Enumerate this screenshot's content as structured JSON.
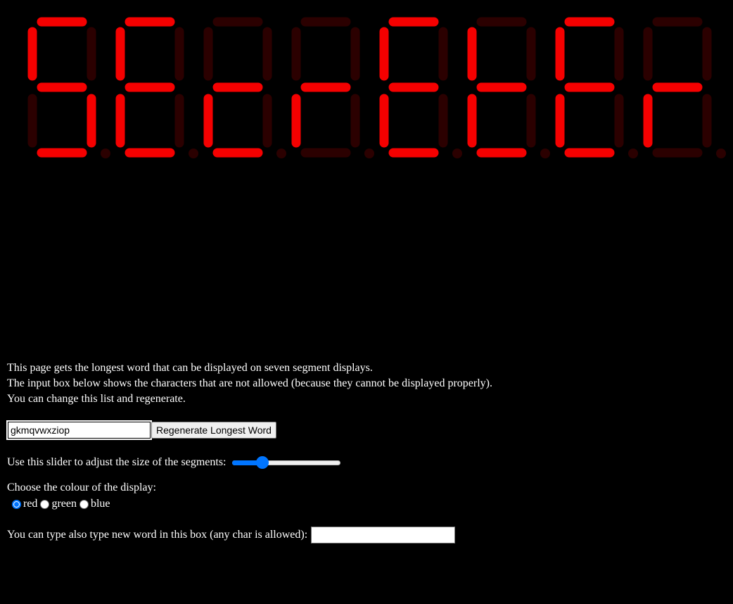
{
  "display": {
    "word": "SEcrEtEr",
    "on_color": "#f50000",
    "off_color": "#2b0000",
    "digits": [
      {
        "char": "S",
        "segments": [
          "a",
          "f",
          "g",
          "c",
          "d"
        ]
      },
      {
        "char": "E",
        "segments": [
          "a",
          "f",
          "g",
          "e",
          "d"
        ]
      },
      {
        "char": "c",
        "segments": [
          "g",
          "e",
          "d"
        ]
      },
      {
        "char": "r",
        "segments": [
          "g",
          "e"
        ]
      },
      {
        "char": "E",
        "segments": [
          "a",
          "f",
          "g",
          "e",
          "d"
        ]
      },
      {
        "char": "t",
        "segments": [
          "f",
          "g",
          "e",
          "d"
        ]
      },
      {
        "char": "E",
        "segments": [
          "a",
          "f",
          "g",
          "e",
          "d"
        ]
      },
      {
        "char": "r",
        "segments": [
          "g",
          "e"
        ]
      }
    ]
  },
  "intro": {
    "line1": "This page gets the longest word that can be displayed on seven segment displays.",
    "line2": "The input box below shows the characters that are not allowed (because they cannot be displayed properly).",
    "line3": "You can change this list and regenerate."
  },
  "disallowed": {
    "value": "gkmqvwxziop",
    "button_label": "Regenerate Longest Word"
  },
  "slider": {
    "label": "Use this slider to adjust the size of the segments:",
    "min": 0,
    "max": 100,
    "value": 25
  },
  "colour": {
    "label": "Choose the colour of the display:",
    "options": [
      {
        "label": "red",
        "checked": true
      },
      {
        "label": "green",
        "checked": false
      },
      {
        "label": "blue",
        "checked": false
      }
    ]
  },
  "custom_word": {
    "label": "You can type also type new word in this box (any char is allowed):",
    "value": ""
  }
}
